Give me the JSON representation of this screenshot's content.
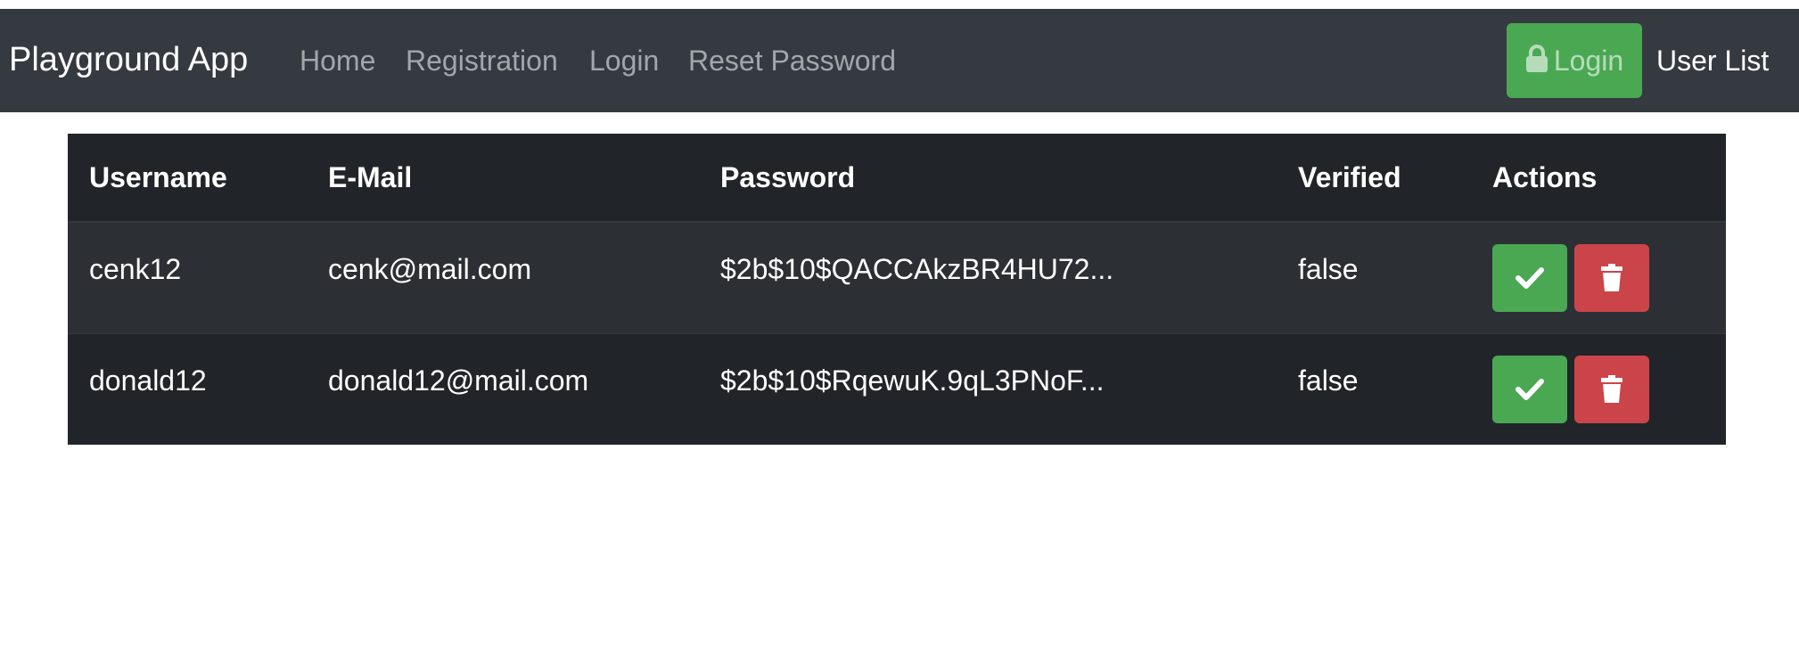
{
  "navbar": {
    "brand": "Playground App",
    "links": [
      "Home",
      "Registration",
      "Login",
      "Reset Password"
    ],
    "login_button": "Login",
    "user_list": "User List"
  },
  "table": {
    "headers": [
      "Username",
      "E-Mail",
      "Password",
      "Verified",
      "Actions"
    ],
    "rows": [
      {
        "username": "cenk12",
        "email": "cenk@mail.com",
        "password": "$2b$10$QACCAkzBR4HU72...",
        "verified": "false"
      },
      {
        "username": "donald12",
        "email": "donald12@mail.com",
        "password": "$2b$10$RqewuK.9qL3PNoF...",
        "verified": "false"
      }
    ]
  },
  "icons": {
    "login": "lock-icon",
    "verify": "check-icon",
    "delete": "trash-icon"
  },
  "colors": {
    "navbar_bg": "#343a40",
    "table_bg": "#212529",
    "success": "#4aa853",
    "danger": "#cb444a"
  }
}
